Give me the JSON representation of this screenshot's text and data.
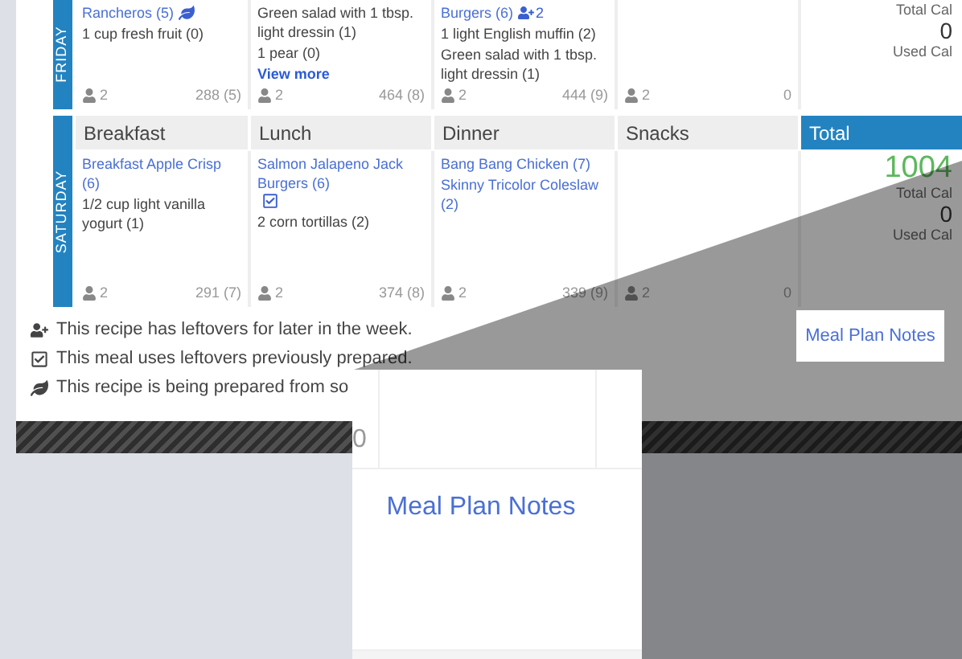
{
  "days": [
    {
      "label": "FRIDAY",
      "meals": [
        {
          "items": [
            {
              "kind": "recipe-leaf",
              "text": "Rancheros (5)"
            },
            {
              "kind": "food",
              "text": "1 cup fresh fruit (0)"
            }
          ],
          "servings": "2",
          "calories": "288 (5)"
        },
        {
          "items": [
            {
              "kind": "food",
              "text": "Green salad with 1 tbsp. light dressin (1)"
            },
            {
              "kind": "food",
              "text": "1 pear (0)"
            },
            {
              "kind": "more",
              "text": "View more"
            }
          ],
          "servings": "2",
          "calories": "464 (8)"
        },
        {
          "items": [
            {
              "kind": "recipe-leftovers",
              "text": "Burgers (6)",
              "leftover_count": "2"
            },
            {
              "kind": "food",
              "text": "1 light English muffin (2)"
            },
            {
              "kind": "food",
              "text": "Green salad with 1 tbsp. light dressin (1)"
            }
          ],
          "servings": "2",
          "calories": "444 (9)"
        },
        {
          "servings": "2",
          "calories": "0"
        }
      ],
      "total": {
        "total_label": "Total Cal",
        "used": "0",
        "used_label": "Used Cal"
      }
    },
    {
      "label": "SATURDAY",
      "headers": [
        {
          "text": "Breakfast",
          "kind": "meal"
        },
        {
          "text": "Lunch",
          "kind": "meal"
        },
        {
          "text": "Dinner",
          "kind": "meal"
        },
        {
          "text": "Snacks",
          "kind": "meal"
        },
        {
          "text": "Total",
          "kind": "total"
        }
      ],
      "meals": [
        {
          "items": [
            {
              "kind": "recipe",
              "text": "Breakfast Apple Crisp (6)"
            },
            {
              "kind": "food",
              "text": "1/2 cup light vanilla yogurt (1)"
            }
          ],
          "servings": "2",
          "calories": "291 (7)"
        },
        {
          "items": [
            {
              "kind": "recipe-uses-leftovers",
              "text": "Salmon Jalapeno Jack Burgers (6)"
            },
            {
              "kind": "food",
              "text": "2 corn tortillas (2)"
            }
          ],
          "servings": "2",
          "calories": "374 (8)"
        },
        {
          "items": [
            {
              "kind": "recipe",
              "text": "Bang Bang Chicken (7)"
            },
            {
              "kind": "recipe",
              "text": "Skinny Tricolor Coleslaw (2)"
            }
          ],
          "servings": "2",
          "calories": "339 (9)"
        },
        {
          "servings": "2",
          "calories": "0"
        }
      ],
      "total": {
        "total": "1004",
        "total_label": "Total Cal",
        "used": "0",
        "used_label": "Used Cal"
      }
    }
  ],
  "legend": [
    {
      "kind": "leftovers",
      "text": "This recipe has leftovers for later in the week."
    },
    {
      "kind": "uses-leftovers",
      "text": "This meal uses leftovers previously prepared."
    },
    {
      "kind": "leaf",
      "text": "This recipe is being prepared from so"
    }
  ],
  "notes_button": "Meal Plan Notes",
  "inset": {
    "cell_value": "0",
    "link": "Meal Plan Notes"
  }
}
